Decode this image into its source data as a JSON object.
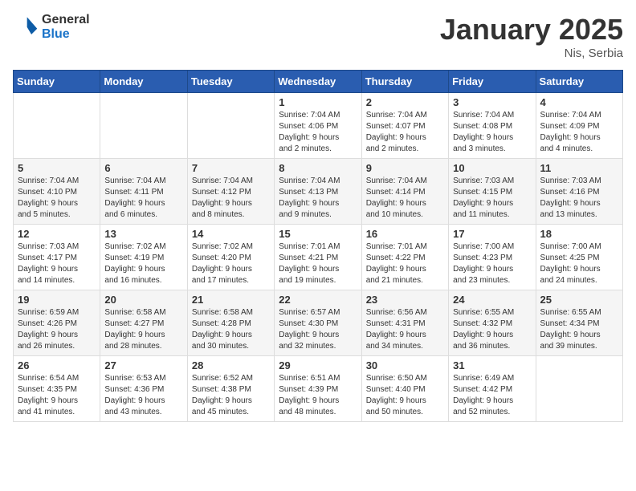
{
  "header": {
    "logo_general": "General",
    "logo_blue": "Blue",
    "month_title": "January 2025",
    "location": "Nis, Serbia"
  },
  "weekdays": [
    "Sunday",
    "Monday",
    "Tuesday",
    "Wednesday",
    "Thursday",
    "Friday",
    "Saturday"
  ],
  "weeks": [
    [
      {
        "day": "",
        "info": ""
      },
      {
        "day": "",
        "info": ""
      },
      {
        "day": "",
        "info": ""
      },
      {
        "day": "1",
        "info": "Sunrise: 7:04 AM\nSunset: 4:06 PM\nDaylight: 9 hours\nand 2 minutes."
      },
      {
        "day": "2",
        "info": "Sunrise: 7:04 AM\nSunset: 4:07 PM\nDaylight: 9 hours\nand 2 minutes."
      },
      {
        "day": "3",
        "info": "Sunrise: 7:04 AM\nSunset: 4:08 PM\nDaylight: 9 hours\nand 3 minutes."
      },
      {
        "day": "4",
        "info": "Sunrise: 7:04 AM\nSunset: 4:09 PM\nDaylight: 9 hours\nand 4 minutes."
      }
    ],
    [
      {
        "day": "5",
        "info": "Sunrise: 7:04 AM\nSunset: 4:10 PM\nDaylight: 9 hours\nand 5 minutes."
      },
      {
        "day": "6",
        "info": "Sunrise: 7:04 AM\nSunset: 4:11 PM\nDaylight: 9 hours\nand 6 minutes."
      },
      {
        "day": "7",
        "info": "Sunrise: 7:04 AM\nSunset: 4:12 PM\nDaylight: 9 hours\nand 8 minutes."
      },
      {
        "day": "8",
        "info": "Sunrise: 7:04 AM\nSunset: 4:13 PM\nDaylight: 9 hours\nand 9 minutes."
      },
      {
        "day": "9",
        "info": "Sunrise: 7:04 AM\nSunset: 4:14 PM\nDaylight: 9 hours\nand 10 minutes."
      },
      {
        "day": "10",
        "info": "Sunrise: 7:03 AM\nSunset: 4:15 PM\nDaylight: 9 hours\nand 11 minutes."
      },
      {
        "day": "11",
        "info": "Sunrise: 7:03 AM\nSunset: 4:16 PM\nDaylight: 9 hours\nand 13 minutes."
      }
    ],
    [
      {
        "day": "12",
        "info": "Sunrise: 7:03 AM\nSunset: 4:17 PM\nDaylight: 9 hours\nand 14 minutes."
      },
      {
        "day": "13",
        "info": "Sunrise: 7:02 AM\nSunset: 4:19 PM\nDaylight: 9 hours\nand 16 minutes."
      },
      {
        "day": "14",
        "info": "Sunrise: 7:02 AM\nSunset: 4:20 PM\nDaylight: 9 hours\nand 17 minutes."
      },
      {
        "day": "15",
        "info": "Sunrise: 7:01 AM\nSunset: 4:21 PM\nDaylight: 9 hours\nand 19 minutes."
      },
      {
        "day": "16",
        "info": "Sunrise: 7:01 AM\nSunset: 4:22 PM\nDaylight: 9 hours\nand 21 minutes."
      },
      {
        "day": "17",
        "info": "Sunrise: 7:00 AM\nSunset: 4:23 PM\nDaylight: 9 hours\nand 23 minutes."
      },
      {
        "day": "18",
        "info": "Sunrise: 7:00 AM\nSunset: 4:25 PM\nDaylight: 9 hours\nand 24 minutes."
      }
    ],
    [
      {
        "day": "19",
        "info": "Sunrise: 6:59 AM\nSunset: 4:26 PM\nDaylight: 9 hours\nand 26 minutes."
      },
      {
        "day": "20",
        "info": "Sunrise: 6:58 AM\nSunset: 4:27 PM\nDaylight: 9 hours\nand 28 minutes."
      },
      {
        "day": "21",
        "info": "Sunrise: 6:58 AM\nSunset: 4:28 PM\nDaylight: 9 hours\nand 30 minutes."
      },
      {
        "day": "22",
        "info": "Sunrise: 6:57 AM\nSunset: 4:30 PM\nDaylight: 9 hours\nand 32 minutes."
      },
      {
        "day": "23",
        "info": "Sunrise: 6:56 AM\nSunset: 4:31 PM\nDaylight: 9 hours\nand 34 minutes."
      },
      {
        "day": "24",
        "info": "Sunrise: 6:55 AM\nSunset: 4:32 PM\nDaylight: 9 hours\nand 36 minutes."
      },
      {
        "day": "25",
        "info": "Sunrise: 6:55 AM\nSunset: 4:34 PM\nDaylight: 9 hours\nand 39 minutes."
      }
    ],
    [
      {
        "day": "26",
        "info": "Sunrise: 6:54 AM\nSunset: 4:35 PM\nDaylight: 9 hours\nand 41 minutes."
      },
      {
        "day": "27",
        "info": "Sunrise: 6:53 AM\nSunset: 4:36 PM\nDaylight: 9 hours\nand 43 minutes."
      },
      {
        "day": "28",
        "info": "Sunrise: 6:52 AM\nSunset: 4:38 PM\nDaylight: 9 hours\nand 45 minutes."
      },
      {
        "day": "29",
        "info": "Sunrise: 6:51 AM\nSunset: 4:39 PM\nDaylight: 9 hours\nand 48 minutes."
      },
      {
        "day": "30",
        "info": "Sunrise: 6:50 AM\nSunset: 4:40 PM\nDaylight: 9 hours\nand 50 minutes."
      },
      {
        "day": "31",
        "info": "Sunrise: 6:49 AM\nSunset: 4:42 PM\nDaylight: 9 hours\nand 52 minutes."
      },
      {
        "day": "",
        "info": ""
      }
    ]
  ]
}
